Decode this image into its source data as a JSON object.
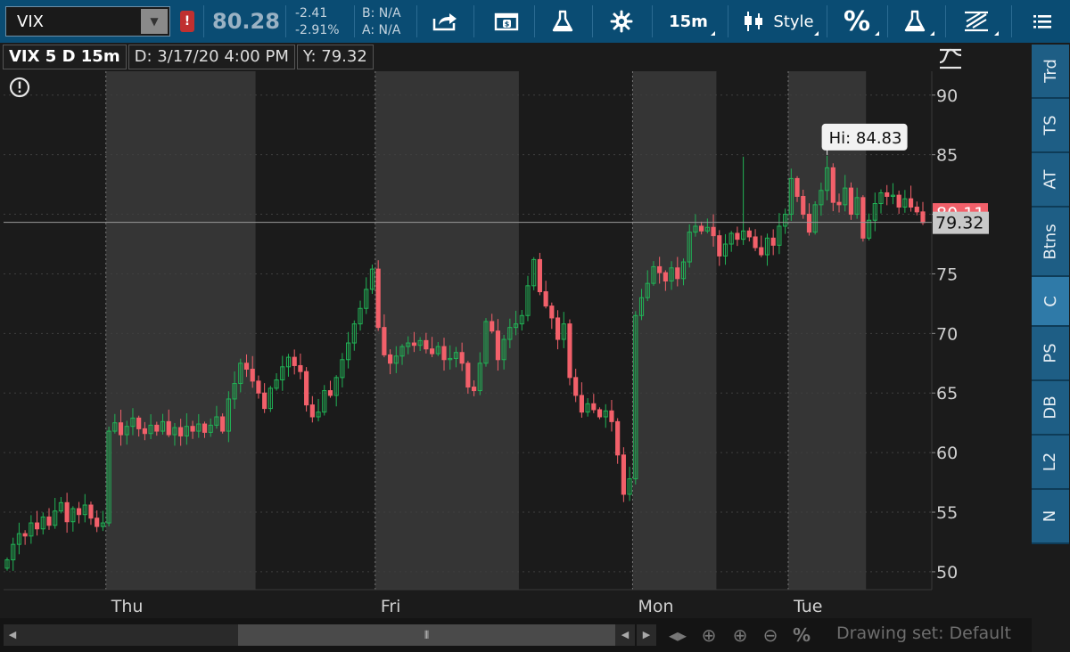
{
  "toolbar": {
    "symbol": "VIX",
    "alert_badge": "!",
    "last_price": "80.28",
    "net_change": "-2.41",
    "pct_change": "-2.91%",
    "bid": "B: N/A",
    "ask": "A: N/A",
    "timeframe_label": "15m",
    "style_label": "Style",
    "percent_label": "%"
  },
  "chart_header": {
    "title": "VIX 5 D 15m",
    "date_readout": "D: 3/17/20 4:00 PM",
    "y_readout": "Y: 79.32"
  },
  "right_tabs": [
    "Trd",
    "TS",
    "AT",
    "Btns",
    "C",
    "PS",
    "DB",
    "L2",
    "N"
  ],
  "bottom_bar": {
    "drawing_set": "Drawing set: Default"
  },
  "colors": {
    "up": "#21b356",
    "down": "#f2606a",
    "background": "#1b1b1b",
    "shaded_session": "#3a3a3a",
    "toolbar": "#0a4c73"
  },
  "chart_data": {
    "type": "candlestick",
    "symbol": "VIX",
    "interval": "15m",
    "ylim": [
      48.5,
      92
    ],
    "yticks": [
      50,
      55,
      60,
      65,
      70,
      75,
      80,
      85,
      90
    ],
    "grid": true,
    "x_labels": [
      "Thu",
      "Fri",
      "Mon",
      "Tue"
    ],
    "current_price_label": "80.11",
    "crosshair_label": "79.32",
    "annotation": "Hi: 84.83",
    "high": 84.83,
    "closes": [
      51.0,
      52.3,
      53.2,
      53.0,
      54.1,
      53.6,
      54.6,
      53.9,
      55.1,
      55.8,
      54.2,
      55.3,
      54.8,
      55.6,
      54.5,
      53.8,
      54.1,
      61.8,
      62.5,
      61.5,
      62.2,
      62.9,
      62.0,
      61.6,
      62.3,
      61.8,
      62.6,
      61.5,
      62.1,
      61.4,
      62.2,
      61.8,
      62.4,
      61.7,
      62.3,
      63.0,
      61.8,
      64.5,
      65.8,
      67.5,
      67.0,
      66.0,
      65.0,
      63.7,
      65.4,
      66.1,
      67.2,
      68.0,
      67.3,
      66.8,
      64.0,
      63.0,
      63.4,
      65.2,
      64.8,
      66.3,
      67.8,
      69.2,
      70.8,
      72.1,
      73.7,
      75.4,
      70.5,
      68.2,
      67.5,
      68.1,
      68.9,
      69.2,
      69.0,
      69.4,
      68.7,
      68.3,
      68.9,
      67.8,
      67.9,
      68.4,
      67.5,
      65.5,
      65.2,
      67.5,
      71.0,
      70.2,
      67.8,
      69.5,
      70.5,
      70.8,
      71.5,
      74.0,
      76.2,
      73.5,
      72.3,
      71.3,
      69.5,
      70.8,
      66.3,
      64.8,
      63.4,
      64.1,
      63.6,
      63.0,
      63.5,
      62.6,
      59.8,
      56.5,
      57.8,
      71.5,
      73.0,
      74.2,
      75.6,
      75.1,
      74.4,
      75.5,
      74.6,
      76.0,
      78.5,
      79.0,
      78.6,
      78.9,
      78.2,
      76.5,
      77.5,
      78.4,
      77.9,
      78.6,
      78.1,
      77.2,
      76.6,
      78.0,
      77.4,
      79.0,
      80.0,
      83.0,
      81.5,
      80.0,
      78.5,
      80.8,
      82.0,
      83.9,
      81.0,
      80.8,
      82.2,
      80.0,
      81.4,
      78.0,
      79.5,
      80.9,
      81.8,
      81.5,
      81.6,
      80.6,
      81.3,
      80.6,
      80.2,
      79.3
    ],
    "sessions": [
      {
        "label": "Thu",
        "start_index": 17
      },
      {
        "label": "Fri",
        "start_index": 62
      },
      {
        "label": "Mon",
        "start_index": 105
      },
      {
        "label": "Tue",
        "start_index": 131
      }
    ]
  }
}
